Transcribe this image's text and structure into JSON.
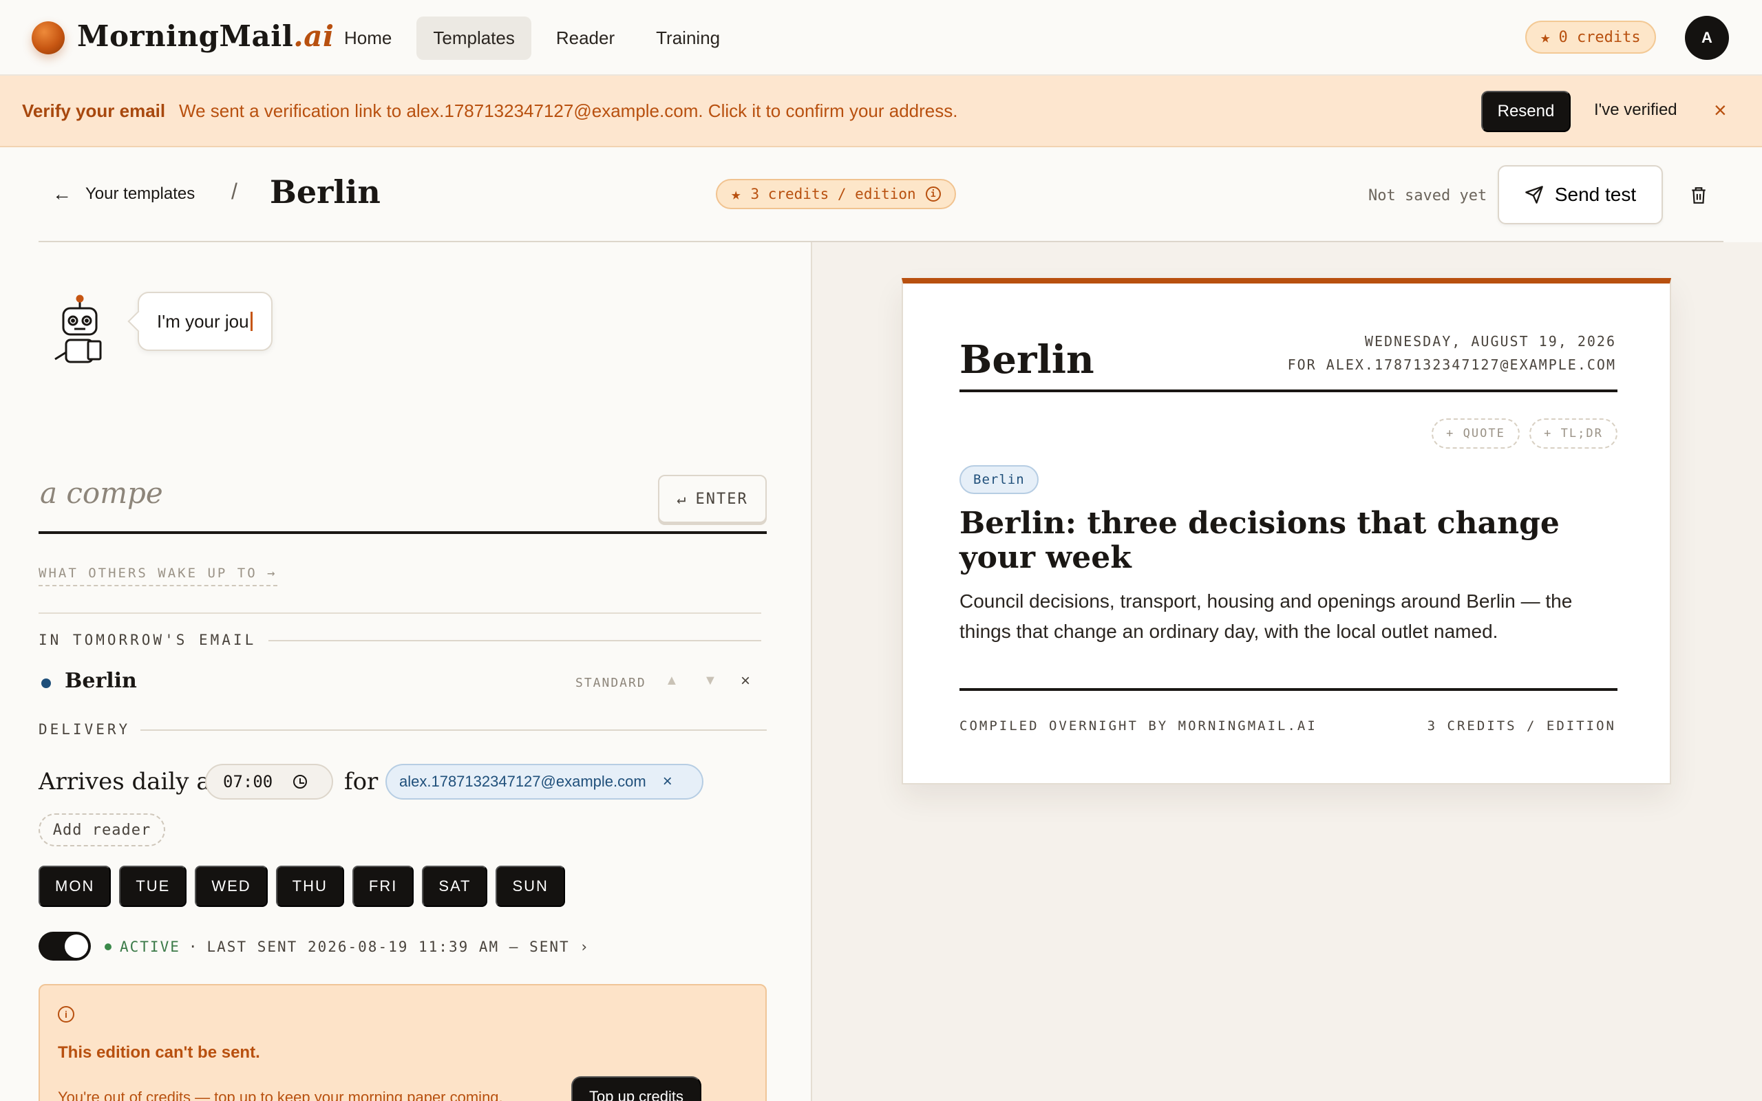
{
  "brand": {
    "name": "MorningMail",
    "suffix": ".ai"
  },
  "nav": {
    "items": [
      {
        "label": "Home"
      },
      {
        "label": "Templates"
      },
      {
        "label": "Reader"
      },
      {
        "label": "Training"
      }
    ],
    "active": "Templates"
  },
  "account": {
    "credits_label": "0 credits",
    "avatar_initial": "A"
  },
  "banner": {
    "title": "Verify your email",
    "message": "We sent a verification link to alex.1787132347127@example.com. Click it to confirm your address.",
    "resend_label": "Resend",
    "verified_label": "I've verified",
    "close_glyph": "×"
  },
  "header": {
    "back_label": "Your templates",
    "separator": "/",
    "title": "Berlin",
    "cost_label": "3 credits / edition",
    "save_status": "Not saved yet",
    "send_test_label": "Send test"
  },
  "composer": {
    "assistant_text": "I'm your jou",
    "input_value": "a compe",
    "enter_label": "ENTER",
    "others_link": "WHAT OTHERS WAKE UP TO →"
  },
  "tomorrow": {
    "label": "IN TOMORROW'S EMAIL",
    "topics": [
      {
        "name": "Berlin",
        "mode": "STANDARD",
        "color": "#1f4f7a"
      }
    ]
  },
  "delivery": {
    "label": "DELIVERY",
    "arrives_text": "Arrives daily at",
    "time": "07:00",
    "for_text": "for",
    "recipient": "alex.1787132347127@example.com",
    "add_reader_label": "Add reader",
    "days": [
      "MON",
      "TUE",
      "WED",
      "THU",
      "FRI",
      "SAT",
      "SUN"
    ]
  },
  "status": {
    "active_label": "ACTIVE",
    "separator": "·",
    "last_sent": "LAST SENT 2026-08-19 11:39 AM — SENT ›",
    "active": true
  },
  "warning": {
    "title": "This edition can't be sent.",
    "text": "You're out of credits — top up to keep your morning paper coming.",
    "button_label": "Top up credits"
  },
  "preview": {
    "title": "Berlin",
    "date": "WEDNESDAY, AUGUST 19, 2026",
    "for_line": "FOR ALEX.1787132347127@EXAMPLE.COM",
    "quote_chip": "+ QUOTE",
    "tldr_chip": "+ TL;DR",
    "topic_tag": "Berlin",
    "headline": "Berlin: three decisions that change your week",
    "summary": "Council decisions, transport, housing and openings around Berlin — the things that change an ordinary day, with the local outlet named.",
    "footer_left": "COMPILED OVERNIGHT BY MORNINGMAIL.AI",
    "footer_right": "3 CREDITS / EDITION"
  },
  "colors": {
    "accent": "#b8500f",
    "banner_bg": "#fde6cf",
    "ink": "#141210",
    "topic_blue": "#1f4f7a",
    "active_green": "#3b7a48"
  }
}
